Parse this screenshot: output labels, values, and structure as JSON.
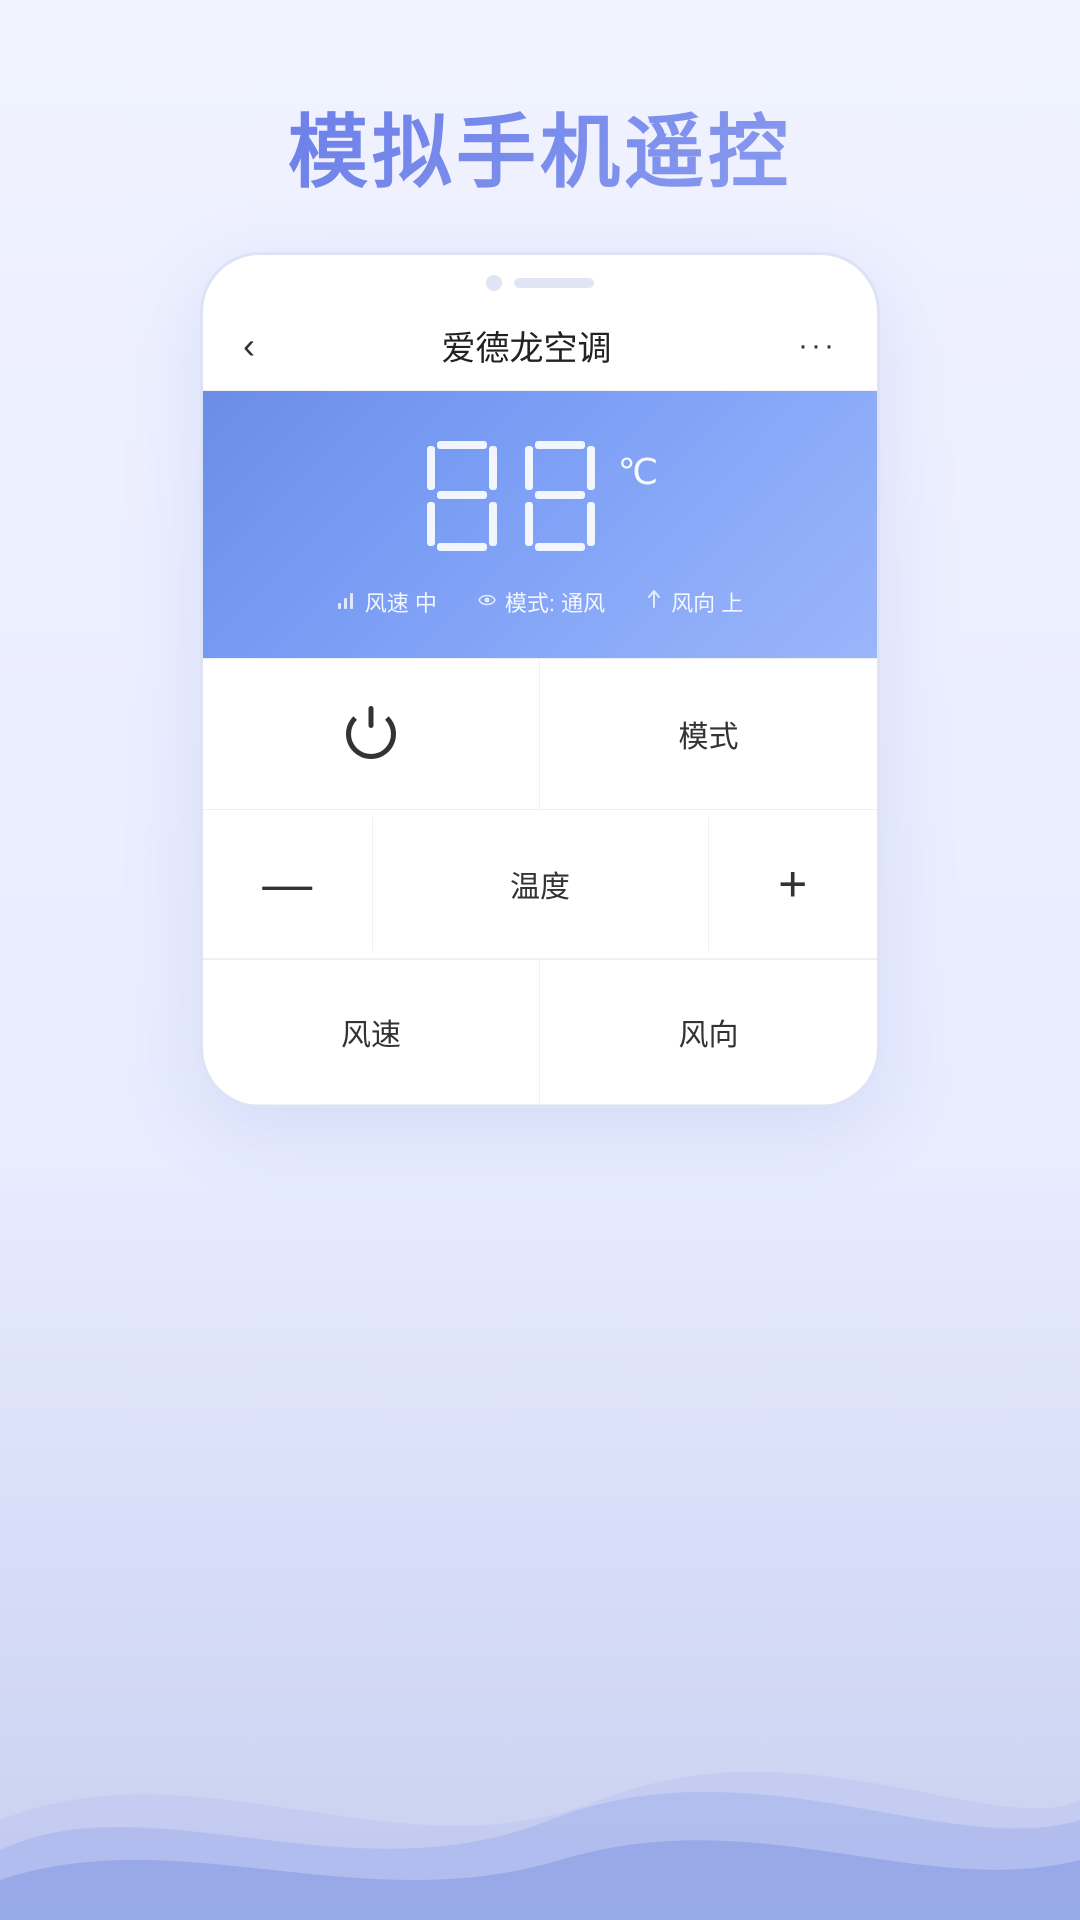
{
  "page": {
    "title": "模拟手机遥控",
    "background_color": "#eef0ff"
  },
  "header": {
    "back_label": "‹",
    "title": "爱德龙空调",
    "more_label": "···"
  },
  "ac_display": {
    "temperature": "88",
    "unit": "℃",
    "wind_speed_icon": "📶",
    "wind_speed_label": "风速 中",
    "mode_icon": "⇒",
    "mode_label": "模式: 通风",
    "wind_dir_icon": "↑",
    "wind_dir_label": "风向 上"
  },
  "controls": {
    "power_label": "",
    "mode_label": "模式",
    "temp_decrease_label": "—",
    "temp_title": "温度",
    "temp_increase_label": "+",
    "wind_speed_label": "风速",
    "wind_dir_label": "风向"
  }
}
